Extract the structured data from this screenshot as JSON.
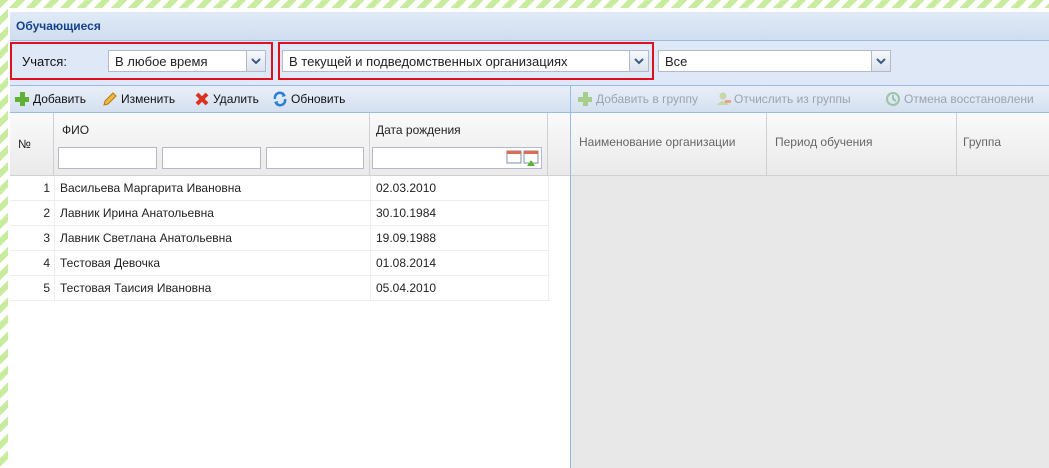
{
  "panel": {
    "title": "Обучающиеся"
  },
  "filters": {
    "study_label": "Учатся:",
    "study_time": "В любое время",
    "organization_scope": "В текущей и подведомственных организациях",
    "extra_filter": "Все"
  },
  "left_toolbar": {
    "add": "Добавить",
    "edit": "Изменить",
    "delete": "Удалить",
    "refresh": "Обновить"
  },
  "right_toolbar": {
    "add_to_group": "Добавить в группу",
    "expel_from_group": "Отчислить из группы",
    "cancel_restore": "Отмена восстановлени"
  },
  "left_grid": {
    "columns": [
      "№",
      "ФИО",
      "Дата рождения"
    ],
    "rows": [
      {
        "num": "1",
        "fio": "Васильева Маргарита Ивановна",
        "dob": "02.03.2010"
      },
      {
        "num": "2",
        "fio": "Лавник Ирина Анатольевна",
        "dob": "30.10.1984"
      },
      {
        "num": "3",
        "fio": "Лавник Светлана Анатольевна",
        "dob": "19.09.1988"
      },
      {
        "num": "4",
        "fio": "Тестовая Девочка",
        "dob": "01.08.2014"
      },
      {
        "num": "5",
        "fio": "Тестовая Таисия Ивановна",
        "dob": "05.04.2010"
      }
    ]
  },
  "right_grid": {
    "columns": [
      "Наименование организации",
      "Период обучения",
      "Группа"
    ]
  },
  "colors": {
    "highlight": "#e0101c",
    "header_text": "#15428b",
    "add_icon": "#5fb136",
    "delete_icon": "#d9331f",
    "refresh_icon": "#2c7fd0"
  },
  "icons": {
    "add": "plus-icon",
    "edit": "pencil-icon",
    "delete": "cross-icon",
    "refresh": "refresh-icon",
    "expel": "group-remove-icon",
    "cancel_restore": "restore-icon",
    "combo_trigger": "chevron-down-icon",
    "date_filter": "calendar-icon"
  }
}
